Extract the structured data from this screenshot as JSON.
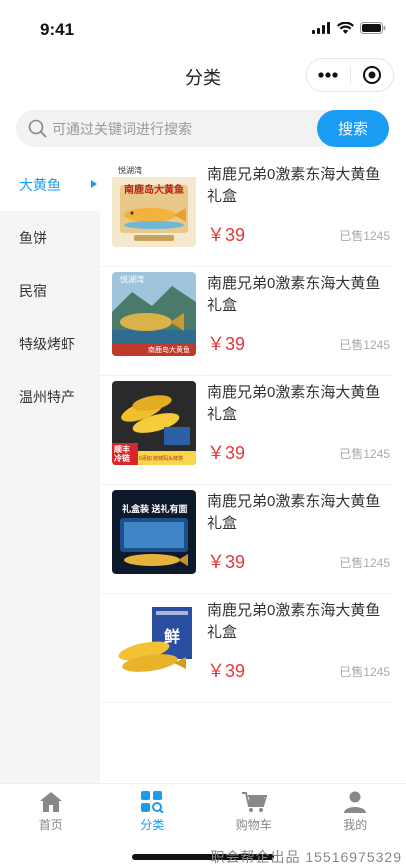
{
  "status_bar": {
    "time": "9:41"
  },
  "nav": {
    "title": "分类"
  },
  "search": {
    "placeholder": "可通过关键词进行搜索",
    "button_label": "搜索"
  },
  "sidebar": {
    "items": [
      {
        "label": "大黄鱼",
        "active": true
      },
      {
        "label": "鱼饼"
      },
      {
        "label": "民宿"
      },
      {
        "label": "特级烤虾"
      },
      {
        "label": "温州特产"
      }
    ]
  },
  "products": [
    {
      "name": "南鹿兄弟0激素东海大黄鱼礼盒",
      "price": "￥39",
      "sold": "已售1245",
      "image": {
        "title": "南鹿岛大黄鱼",
        "brand": "悦湖湾"
      }
    },
    {
      "name": "南鹿兄弟0激素东海大黄鱼礼盒",
      "price": "￥39",
      "sold": "已售1245",
      "image": {
        "title": "南鹿岛大黄鱼",
        "brand": "悦湖湾"
      }
    },
    {
      "name": "南鹿兄弟0激素东海大黄鱼礼盒",
      "price": "￥39",
      "sold": "已售1245",
      "image": {
        "title": "顺丰冷链",
        "brand": "0添加 鲜鲜码头鲜供"
      }
    },
    {
      "name": "南鹿兄弟0激素东海大黄鱼礼盒",
      "price": "￥39",
      "sold": "已售1245",
      "image": {
        "title": "礼盒装 送礼有面"
      }
    },
    {
      "name": "南鹿兄弟0激素东海大黄鱼礼盒",
      "price": "￥39",
      "sold": "已售1245",
      "image": {
        "title": "鲜"
      }
    }
  ],
  "tabbar": {
    "items": [
      {
        "label": "首页",
        "icon": "home-icon"
      },
      {
        "label": "分类",
        "icon": "category-icon",
        "active": true
      },
      {
        "label": "购物车",
        "icon": "cart-icon"
      },
      {
        "label": "我的",
        "icon": "user-icon"
      }
    ]
  },
  "watermark": "职会帮企出品 15516975329",
  "colors": {
    "accent": "#1a9cf2",
    "price": "#e4393c",
    "sidebar_bg": "#f5f5f5"
  }
}
